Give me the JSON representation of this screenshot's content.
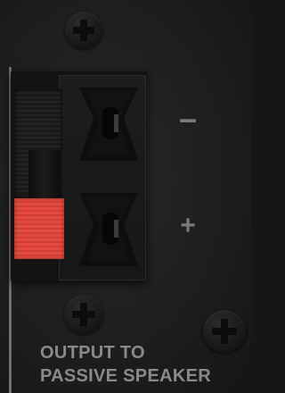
{
  "polarity": {
    "negative_label": "–",
    "positive_label": "+"
  },
  "label": {
    "line1": "OUTPUT TO",
    "line2": "PASSIVE SPEAKER"
  },
  "colors": {
    "panel": "#202020",
    "lever_positive": "#e34a40",
    "lever_negative": "#1a1a1a",
    "text": "#8a8a8a"
  },
  "icons": [
    "screw-icon",
    "screw-icon",
    "screw-icon",
    "socket-icon",
    "socket-icon"
  ]
}
